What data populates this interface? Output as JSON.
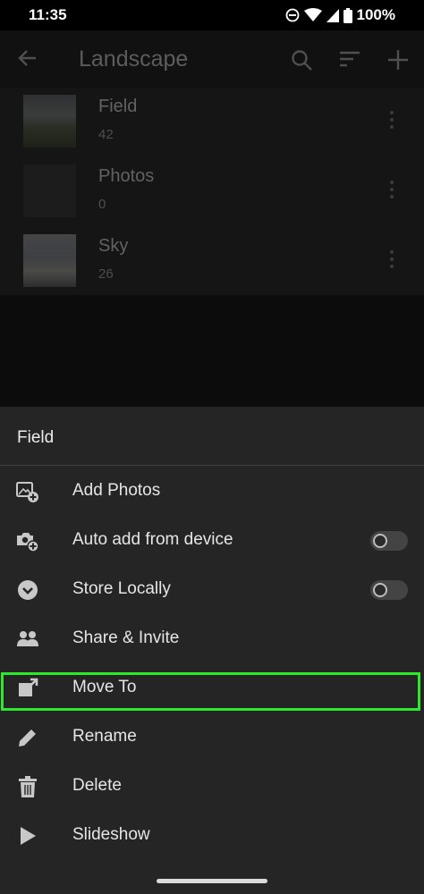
{
  "status_bar": {
    "time": "11:35",
    "battery": "100%"
  },
  "app_bar": {
    "title": "Landscape"
  },
  "albums": [
    {
      "name": "Field",
      "count": "42"
    },
    {
      "name": "Photos",
      "count": "0"
    },
    {
      "name": "Sky",
      "count": "26"
    }
  ],
  "sheet": {
    "title": "Field",
    "items": [
      {
        "label": "Add Photos",
        "icon": "add-photo-icon"
      },
      {
        "label": "Auto add from device",
        "icon": "camera-add-icon",
        "toggle": false
      },
      {
        "label": "Store Locally",
        "icon": "download-circle-icon",
        "toggle": false
      },
      {
        "label": "Share & Invite",
        "icon": "people-icon"
      },
      {
        "label": "Move To",
        "icon": "move-to-icon",
        "highlighted": true
      },
      {
        "label": "Rename",
        "icon": "pencil-icon"
      },
      {
        "label": "Delete",
        "icon": "trash-icon"
      },
      {
        "label": "Slideshow",
        "icon": "play-icon"
      }
    ]
  },
  "colors": {
    "highlight": "#2ee82e",
    "sheet_bg": "#252525",
    "background": "#0c0c0c"
  }
}
